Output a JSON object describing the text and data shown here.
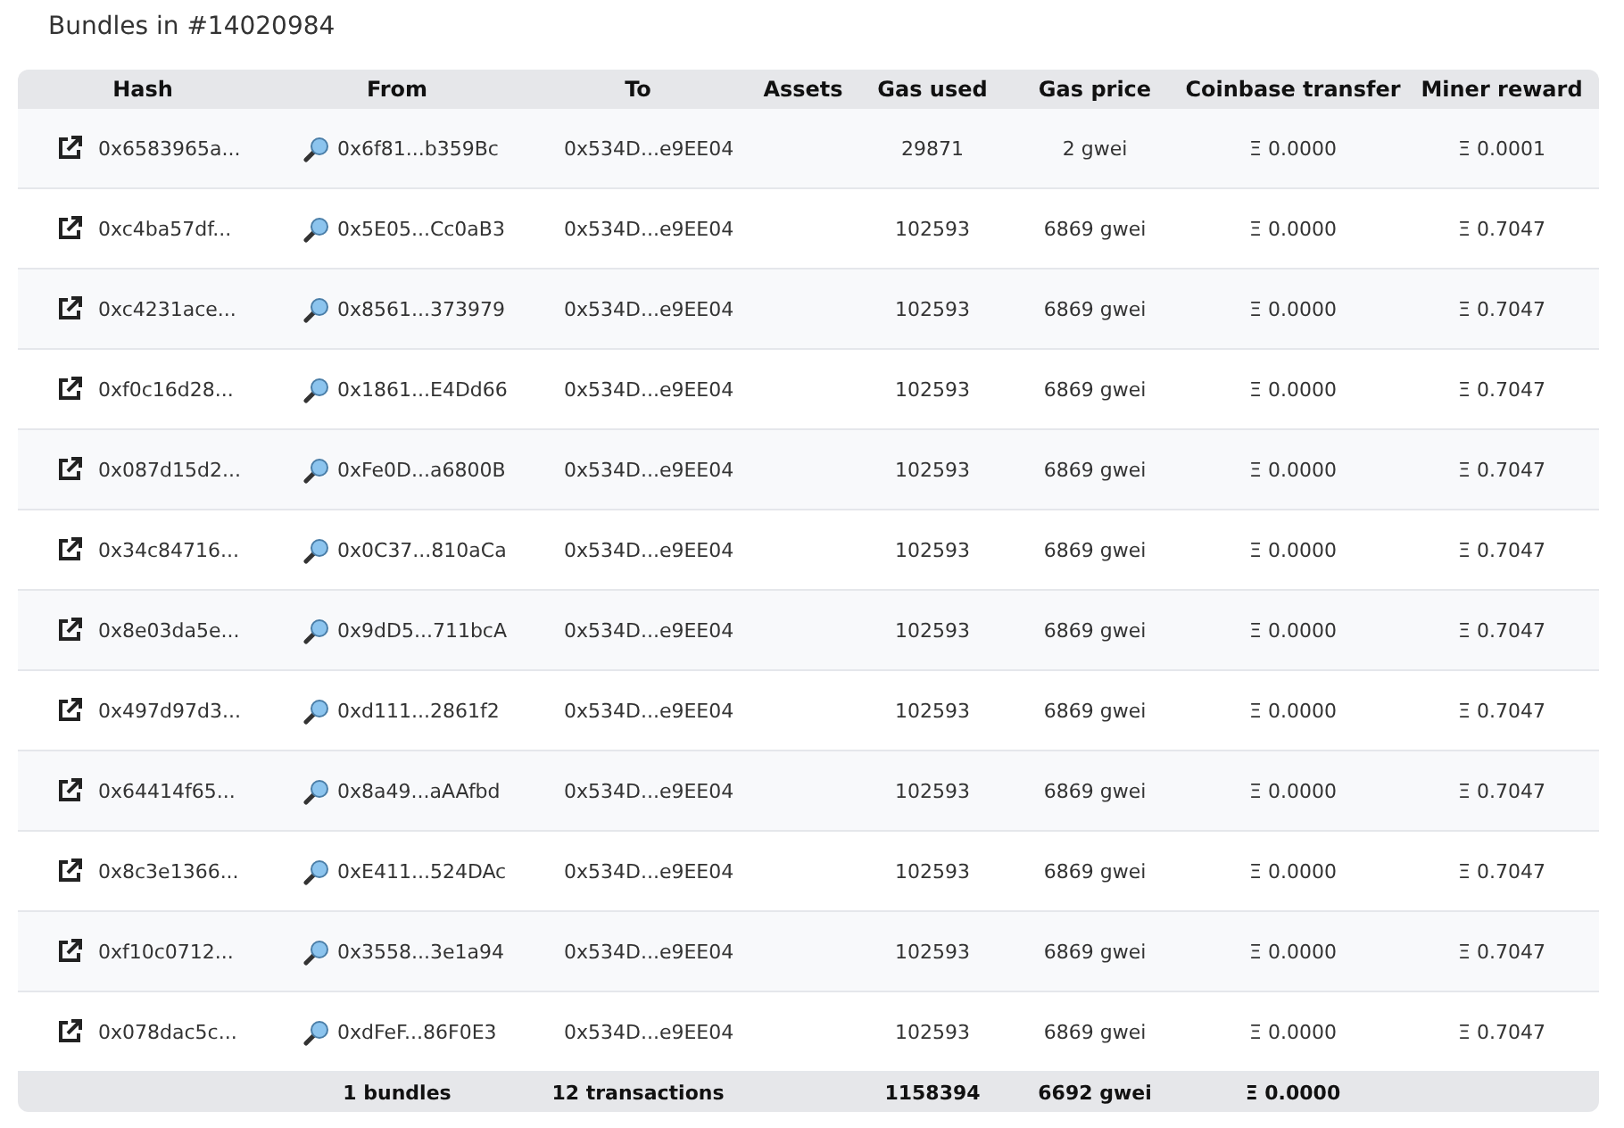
{
  "title": "Bundles in #14020984",
  "columns": [
    "Hash",
    "From",
    "To",
    "Assets",
    "Gas used",
    "Gas price",
    "Coinbase transfer",
    "Miner reward"
  ],
  "rows": [
    {
      "hash": "0x6583965a...",
      "from": "0x6f81...b359Bc",
      "to": "0x534D...e9EE04",
      "gas_used": "29871",
      "gas_price": "2 gwei",
      "coinbase_transfer": "Ξ 0.0000",
      "miner_reward": "Ξ 0.0001"
    },
    {
      "hash": "0xc4ba57df...",
      "from": "0x5E05...Cc0aB3",
      "to": "0x534D...e9EE04",
      "gas_used": "102593",
      "gas_price": "6869 gwei",
      "coinbase_transfer": "Ξ 0.0000",
      "miner_reward": "Ξ 0.7047"
    },
    {
      "hash": "0xc4231ace...",
      "from": "0x8561...373979",
      "to": "0x534D...e9EE04",
      "gas_used": "102593",
      "gas_price": "6869 gwei",
      "coinbase_transfer": "Ξ 0.0000",
      "miner_reward": "Ξ 0.7047"
    },
    {
      "hash": "0xf0c16d28...",
      "from": "0x1861...E4Dd66",
      "to": "0x534D...e9EE04",
      "gas_used": "102593",
      "gas_price": "6869 gwei",
      "coinbase_transfer": "Ξ 0.0000",
      "miner_reward": "Ξ 0.7047"
    },
    {
      "hash": "0x087d15d2...",
      "from": "0xFe0D...a6800B",
      "to": "0x534D...e9EE04",
      "gas_used": "102593",
      "gas_price": "6869 gwei",
      "coinbase_transfer": "Ξ 0.0000",
      "miner_reward": "Ξ 0.7047"
    },
    {
      "hash": "0x34c84716...",
      "from": "0x0C37...810aCa",
      "to": "0x534D...e9EE04",
      "gas_used": "102593",
      "gas_price": "6869 gwei",
      "coinbase_transfer": "Ξ 0.0000",
      "miner_reward": "Ξ 0.7047"
    },
    {
      "hash": "0x8e03da5e...",
      "from": "0x9dD5...711bcA",
      "to": "0x534D...e9EE04",
      "gas_used": "102593",
      "gas_price": "6869 gwei",
      "coinbase_transfer": "Ξ 0.0000",
      "miner_reward": "Ξ 0.7047"
    },
    {
      "hash": "0x497d97d3...",
      "from": "0xd111...2861f2",
      "to": "0x534D...e9EE04",
      "gas_used": "102593",
      "gas_price": "6869 gwei",
      "coinbase_transfer": "Ξ 0.0000",
      "miner_reward": "Ξ 0.7047"
    },
    {
      "hash": "0x64414f65...",
      "from": "0x8a49...aAAfbd",
      "to": "0x534D...e9EE04",
      "gas_used": "102593",
      "gas_price": "6869 gwei",
      "coinbase_transfer": "Ξ 0.0000",
      "miner_reward": "Ξ 0.7047"
    },
    {
      "hash": "0x8c3e1366...",
      "from": "0xE411...524DAc",
      "to": "0x534D...e9EE04",
      "gas_used": "102593",
      "gas_price": "6869 gwei",
      "coinbase_transfer": "Ξ 0.0000",
      "miner_reward": "Ξ 0.7047"
    },
    {
      "hash": "0xf10c0712...",
      "from": "0x3558...3e1a94",
      "to": "0x534D...e9EE04",
      "gas_used": "102593",
      "gas_price": "6869 gwei",
      "coinbase_transfer": "Ξ 0.0000",
      "miner_reward": "Ξ 0.7047"
    },
    {
      "hash": "0x078dac5c...",
      "from": "0xdFeF...86F0E3",
      "to": "0x534D...e9EE04",
      "gas_used": "102593",
      "gas_price": "6869 gwei",
      "coinbase_transfer": "Ξ 0.0000",
      "miner_reward": "Ξ 0.7047"
    }
  ],
  "totals": {
    "bundles": "1 bundles",
    "transactions": "12 transactions",
    "gas_used": "1158394",
    "gas_price": "6692 gwei",
    "coinbase_transfer": "Ξ 0.0000"
  }
}
